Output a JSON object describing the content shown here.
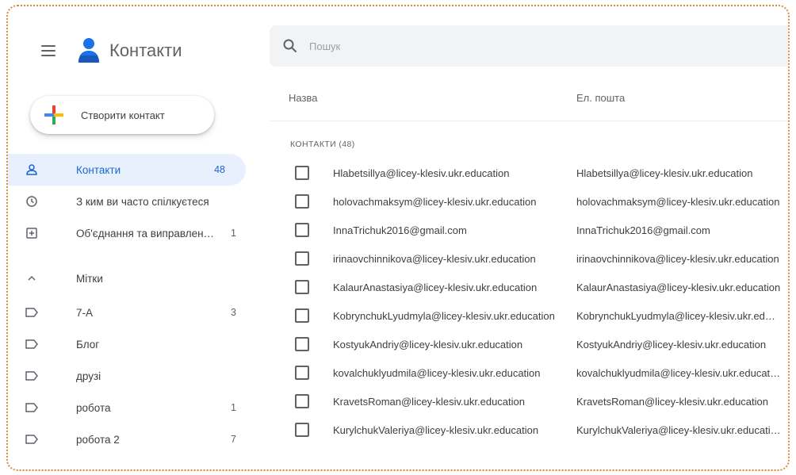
{
  "app": {
    "title": "Контакти"
  },
  "create_button": {
    "label": "Створити контакт"
  },
  "nav": [
    {
      "label": "Контакти",
      "count": "48",
      "icon": "person-icon",
      "active": true
    },
    {
      "label": "З ким ви часто спілкуєтеся",
      "count": "",
      "icon": "history-icon",
      "active": false
    },
    {
      "label": "Об'єднання та виправлення",
      "count": "1",
      "icon": "merge-icon",
      "active": false
    }
  ],
  "labels_section": {
    "title": "Мітки"
  },
  "labels": [
    {
      "label": "7-А",
      "count": "3"
    },
    {
      "label": "Блог",
      "count": ""
    },
    {
      "label": "друзі",
      "count": ""
    },
    {
      "label": "робота",
      "count": "1"
    },
    {
      "label": "робота 2",
      "count": "7"
    }
  ],
  "search": {
    "placeholder": "Пошук",
    "value": ""
  },
  "table": {
    "headers": {
      "name": "Назва",
      "email": "Ел. пошта"
    },
    "section_title": "КОНТАКТИ (48)",
    "rows": [
      {
        "name": "Hlabetsillya@licey-klesiv.ukr.education",
        "email": "Hlabetsillya@licey-klesiv.ukr.education"
      },
      {
        "name": "holovachmaksym@licey-klesiv.ukr.education",
        "email": "holovachmaksym@licey-klesiv.ukr.education"
      },
      {
        "name": "InnaTrichuk2016@gmail.com",
        "email": "InnaTrichuk2016@gmail.com"
      },
      {
        "name": "irinaovchinnikova@licey-klesiv.ukr.education",
        "email": "irinaovchinnikova@licey-klesiv.ukr.education"
      },
      {
        "name": "KalaurAnastasiya@licey-klesiv.ukr.education",
        "email": "KalaurAnastasiya@licey-klesiv.ukr.education"
      },
      {
        "name": "KobrynchukLyudmyla@licey-klesiv.ukr.education",
        "email": "KobrynchukLyudmyla@licey-klesiv.ukr.education"
      },
      {
        "name": "KostyukAndriy@licey-klesiv.ukr.education",
        "email": "KostyukAndriy@licey-klesiv.ukr.education"
      },
      {
        "name": "kovalchuklyudmila@licey-klesiv.ukr.education",
        "email": "kovalchuklyudmila@licey-klesiv.ukr.education"
      },
      {
        "name": "KravetsRoman@licey-klesiv.ukr.education",
        "email": "KravetsRoman@licey-klesiv.ukr.education"
      },
      {
        "name": "KurylchukValeriya@licey-klesiv.ukr.education",
        "email": "KurylchukValeriya@licey-klesiv.ukr.education"
      }
    ]
  },
  "colors": {
    "accent": "#1967d2",
    "active_bg": "#e8f0fe",
    "frame_border": "#d98a3f"
  }
}
